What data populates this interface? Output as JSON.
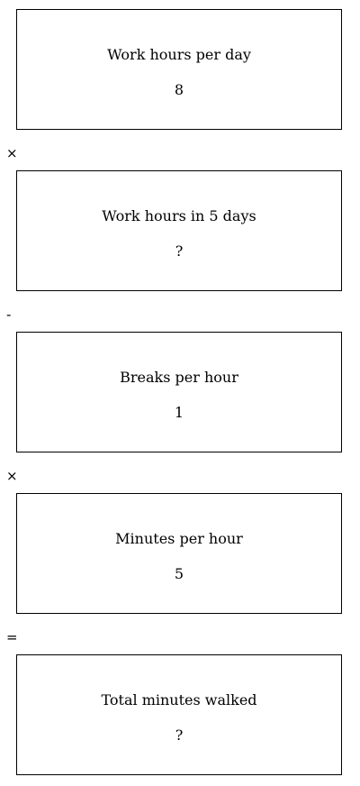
{
  "steps": [
    {
      "label": "Work hours per day",
      "value": "8"
    },
    {
      "label": "Work hours in 5 days",
      "value": "?"
    },
    {
      "label": "Breaks per hour",
      "value": "1"
    },
    {
      "label": "Minutes per hour",
      "value": "5"
    },
    {
      "label": "Total minutes walked",
      "value": "?"
    }
  ],
  "operators": [
    "×",
    "-",
    "×",
    "="
  ]
}
